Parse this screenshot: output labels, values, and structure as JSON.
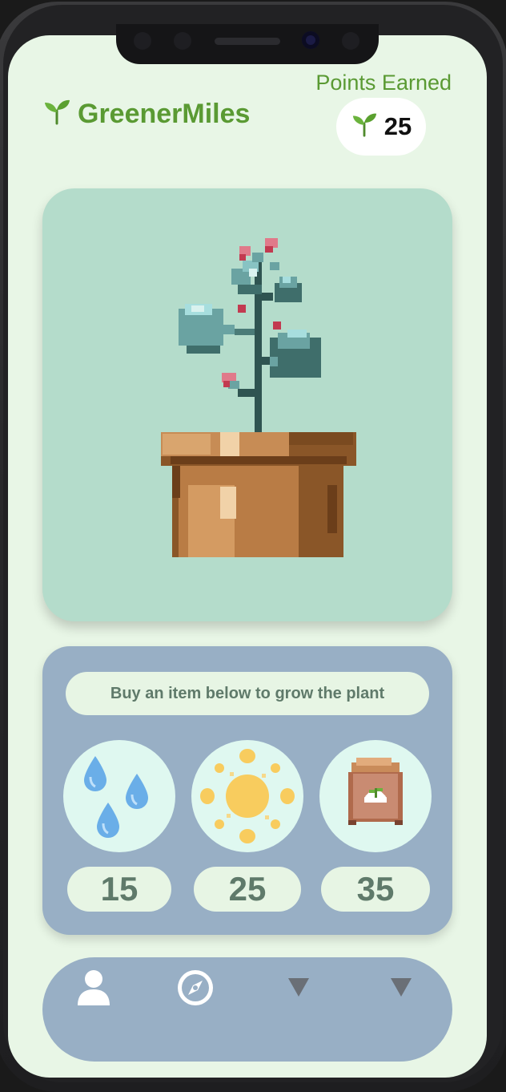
{
  "header": {
    "app_name": "GreenerMiles",
    "points_label": "Points Earned",
    "points_value": "25",
    "brand_icon": "seedling-icon"
  },
  "plant": {
    "icon": "potted-plant-illustration"
  },
  "shop": {
    "hint": "Buy an item below to grow the plant",
    "items": [
      {
        "name": "water",
        "icon": "water-drops-icon",
        "price": "15"
      },
      {
        "name": "sunlight",
        "icon": "sun-icon",
        "price": "25"
      },
      {
        "name": "fertilizer",
        "icon": "fertilizer-bag-icon",
        "price": "35"
      }
    ]
  },
  "tabbar": {
    "tabs": [
      {
        "name": "profile",
        "icon": "person-icon"
      },
      {
        "name": "explore",
        "icon": "compass-icon"
      },
      {
        "name": "tab-3",
        "icon": "triangle-down-icon"
      },
      {
        "name": "tab-4",
        "icon": "triangle-down-icon"
      }
    ]
  },
  "colors": {
    "brand_green": "#5a9a33",
    "background": "#e8f6e6",
    "plant_card": "#b4dccb",
    "panel_blue": "#98afc5",
    "pill": "#e7f5e4",
    "pill_text": "#5f7a6a"
  }
}
